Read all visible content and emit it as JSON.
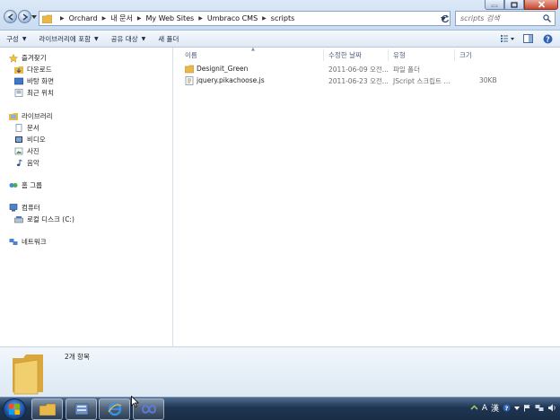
{
  "address": {
    "crumbs": [
      "Orchard",
      "내 문서",
      "My Web Sites",
      "Umbraco CMS",
      "scripts"
    ]
  },
  "search": {
    "placeholder": "scripts 검색"
  },
  "toolbar": {
    "organize": "구성",
    "include_in_library": "라이브러리에 포함",
    "share_with": "공유 대상",
    "new_folder": "새 폴더"
  },
  "nav": {
    "favorites": "즐겨찾기",
    "downloads": "다운로드",
    "desktop": "바탕 화면",
    "recent_places": "최근 위치",
    "libraries": "라이브러리",
    "documents": "문서",
    "videos": "비디오",
    "pictures": "사진",
    "music": "음악",
    "homegroup": "홈 그룹",
    "computer": "컴퓨터",
    "local_disk": "로컬 디스크 (C:)",
    "network": "네트워크"
  },
  "columns": {
    "name": "이름",
    "date": "수정한 날짜",
    "type": "유형",
    "size": "크기"
  },
  "files": [
    {
      "name": "Designit_Green",
      "date": "2011-06-09 오전...",
      "type": "파일 폴더",
      "size": "",
      "icon": "folder-icon"
    },
    {
      "name": "jquery.pikachoose.js",
      "date": "2011-06-23 오전...",
      "type": "JScript 스크립트 ...",
      "size": "30KB",
      "icon": "script-file-icon"
    }
  ],
  "details": {
    "count": "2개 항목"
  },
  "taskbar": {
    "tray_lang": "A",
    "tray_ime": "漢"
  },
  "colors": {
    "accent": "#1e4f9c",
    "folder": "#e8b84a"
  }
}
